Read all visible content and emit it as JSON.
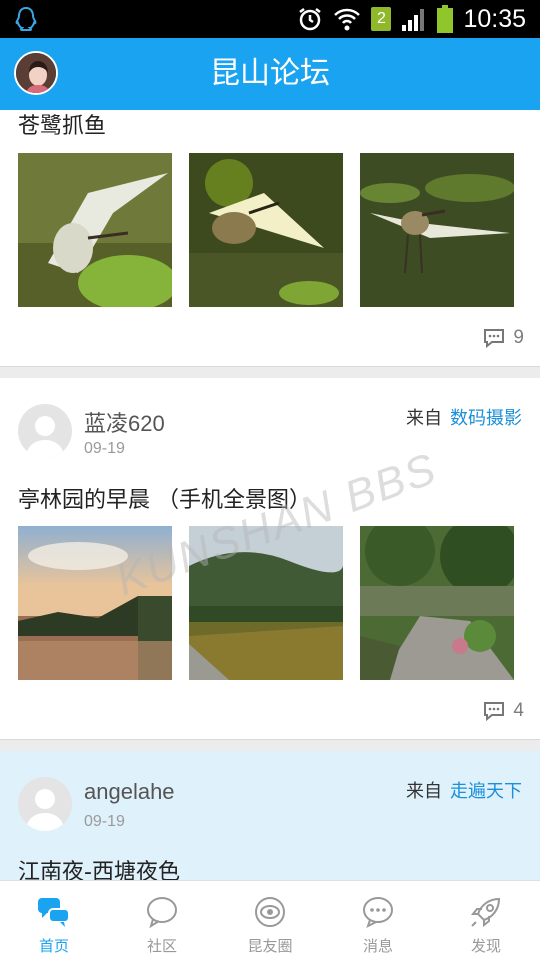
{
  "status_bar": {
    "time": "10:35",
    "sim_slot": "2",
    "icons": [
      "qq-icon",
      "alarm-icon",
      "wifi-icon",
      "signal-icon",
      "battery-icon"
    ]
  },
  "header": {
    "title": "昆山论坛",
    "accent_color": "#1aa3f0"
  },
  "watermark": "KUNSHAN BBS",
  "posts": [
    {
      "title": "苍鹭抓鱼",
      "comment_count": "9",
      "photos": [
        "heron-photo-1",
        "heron-photo-2",
        "heron-photo-3"
      ]
    },
    {
      "author": "蓝凌620",
      "date": "09-19",
      "source_prefix": "来自",
      "board": "数码摄影",
      "title": "亭林园的早晨  （手机全景图）",
      "comment_count": "4",
      "photos": [
        "lake-sunrise-photo",
        "garden-field-photo",
        "park-path-photo"
      ]
    },
    {
      "author": "angelahe",
      "date": "09-19",
      "source_prefix": "来自",
      "board": "走遍天下",
      "title": "江南夜-西塘夜色"
    }
  ],
  "bottom_nav": [
    {
      "label": "首页",
      "icon": "home-chat-icon",
      "active": true
    },
    {
      "label": "社区",
      "icon": "community-bubble-icon",
      "active": false
    },
    {
      "label": "昆友圈",
      "icon": "friends-circle-icon",
      "active": false
    },
    {
      "label": "消息",
      "icon": "message-icon",
      "active": false
    },
    {
      "label": "发现",
      "icon": "rocket-icon",
      "active": false
    }
  ]
}
